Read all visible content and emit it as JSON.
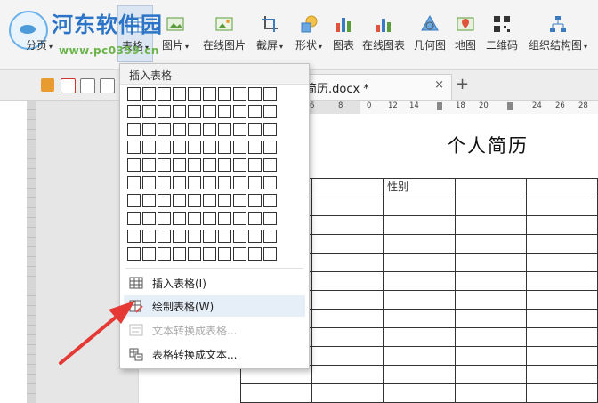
{
  "watermark": {
    "site_name": "河东软件园",
    "url": "www.pc0359.cn"
  },
  "ribbon": {
    "items": [
      {
        "label": "分页",
        "has_arrow": true
      },
      {
        "label": "表格",
        "has_arrow": true
      },
      {
        "label": "图片",
        "has_arrow": true
      },
      {
        "label": "在线图片",
        "has_arrow": false
      },
      {
        "label": "截屏",
        "has_arrow": true
      },
      {
        "label": "形状",
        "has_arrow": true
      },
      {
        "label": "图表",
        "has_arrow": false
      },
      {
        "label": "在线图表",
        "has_arrow": false
      },
      {
        "label": "几何图",
        "has_arrow": false
      },
      {
        "label": "地图",
        "has_arrow": false
      },
      {
        "label": "二维码",
        "has_arrow": false
      },
      {
        "label": "组织结构图",
        "has_arrow": true
      }
    ]
  },
  "tab": {
    "title": "简历.docx *",
    "close": "×",
    "new_tab": "+"
  },
  "ruler": {
    "ticks": [
      "6",
      "8",
      "0",
      "12",
      "14",
      "18",
      "20",
      "24",
      "26",
      "28"
    ]
  },
  "document": {
    "title": "个人简历",
    "cell_gender": "性别"
  },
  "dropdown": {
    "header": "插入表格",
    "grid_rows": 10,
    "grid_cols": 10,
    "items": [
      {
        "label": "插入表格(I)",
        "icon": "table-icon",
        "disabled": false
      },
      {
        "label": "绘制表格(W)",
        "icon": "pencil-table-icon",
        "disabled": false
      },
      {
        "label": "文本转换成表格...",
        "icon": "text-to-table-icon",
        "disabled": true
      },
      {
        "label": "表格转换成文本...",
        "icon": "table-to-text-icon",
        "disabled": false
      }
    ]
  },
  "colors": {
    "arrow": "#e53935",
    "accent": "#2b74c7",
    "hover": "#e6eef8"
  }
}
